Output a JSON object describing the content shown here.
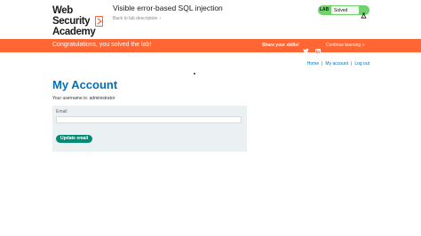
{
  "header": {
    "logo_line1": "Web Security",
    "logo_line2": "Academy",
    "lab_title": "Visible error-based SQL injection",
    "back_link": "Back to lab description",
    "status": {
      "tag": "LAB",
      "value": "Solved",
      "color": "#70d16d"
    }
  },
  "banner": {
    "message": "Congratulations, you solved the lab!",
    "share": "Share your skills!",
    "continue": "Continue learning",
    "color": "#ff6633"
  },
  "nav": {
    "items": [
      "Home",
      "My account",
      "Log out"
    ],
    "separator": "|"
  },
  "main": {
    "title": "My Account",
    "username_line": "Your username is: administrator",
    "email_label": "Email",
    "email_value": "",
    "update_button": "Update email"
  }
}
